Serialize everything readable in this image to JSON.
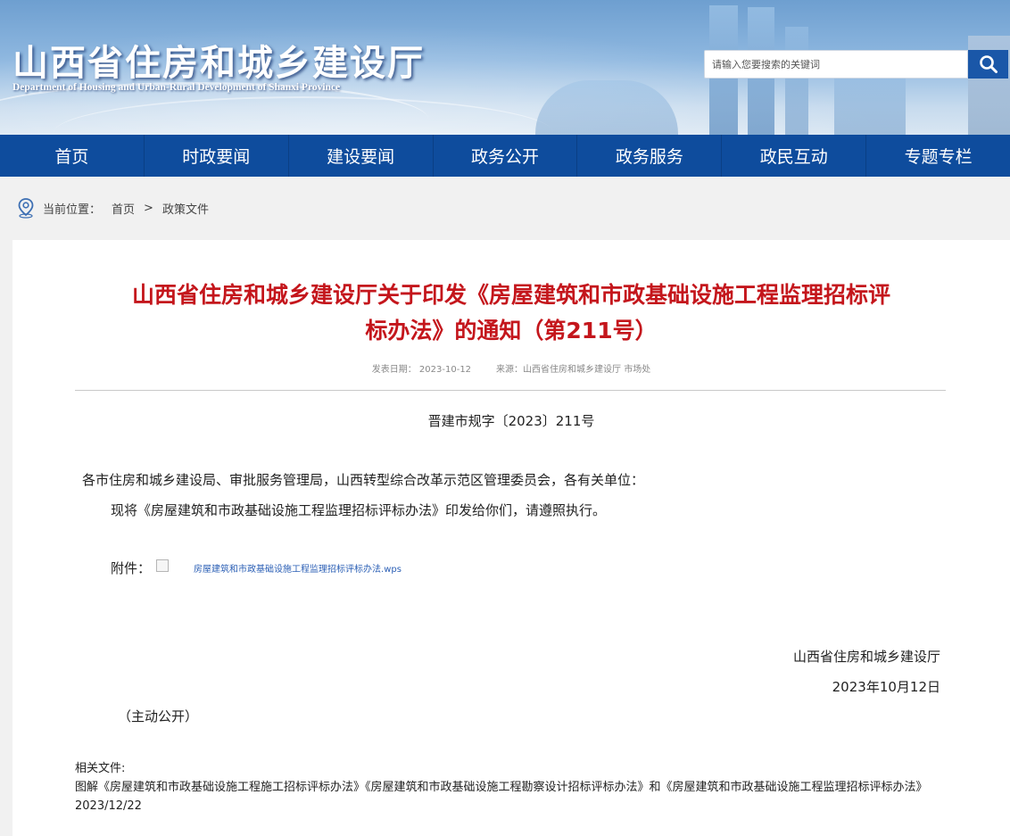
{
  "header": {
    "site_title": "山西省住房和城乡建设厅",
    "site_title_en": "Department of Housing and Urban-Rural Development of Shanxi Province",
    "search_placeholder": "请输入您要搜索的关键词",
    "search_icon": "search-icon",
    "accent_color": "#0e4c9d"
  },
  "nav": {
    "items": [
      "首页",
      "时政要闻",
      "建设要闻",
      "政务公开",
      "政务服务",
      "政民互动",
      "专题专栏"
    ]
  },
  "breadcrumb": {
    "icon": "location-pin-icon",
    "prefix": "当前位置：",
    "items": [
      "首页",
      "政策文件"
    ],
    "separator": ">"
  },
  "article": {
    "title_line1": "山西省住房和城乡建设厅关于印发《房屋建筑和市政基础设施工程监理招标评",
    "title_line2": "标办法》的通知（第211号）",
    "title_color": "#c4161c",
    "publish_date": "发表日期： 2023-10-12",
    "source": "来源：山西省住房和城乡建设厅 市场处",
    "doc_number": "晋建市规字〔2023〕211号",
    "addressee": "各市住房和城乡建设局、审批服务管理局，山西转型综合改革示范区管理委员会，各有关单位：",
    "body": "现将《房屋建筑和市政基础设施工程监理招标评标办法》印发给你们，请遵照执行。",
    "attachment_label": "附件：",
    "attachment_link": "房屋建筑和市政基础设施工程监理招标评标办法.wps",
    "issuer": "山西省住房和城乡建设厅",
    "issue_date": "2023年10月12日",
    "disclosure": "（主动公开）",
    "related_label": "相关文件:",
    "related_text": "图解《房屋建筑和市政基础设施工程施工招标评标办法》《房屋建筑和市政基础设施工程勘察设计招标评标办法》和《房屋建筑和市政基础设施工程监理招标评标办法》 2023/12/22"
  }
}
